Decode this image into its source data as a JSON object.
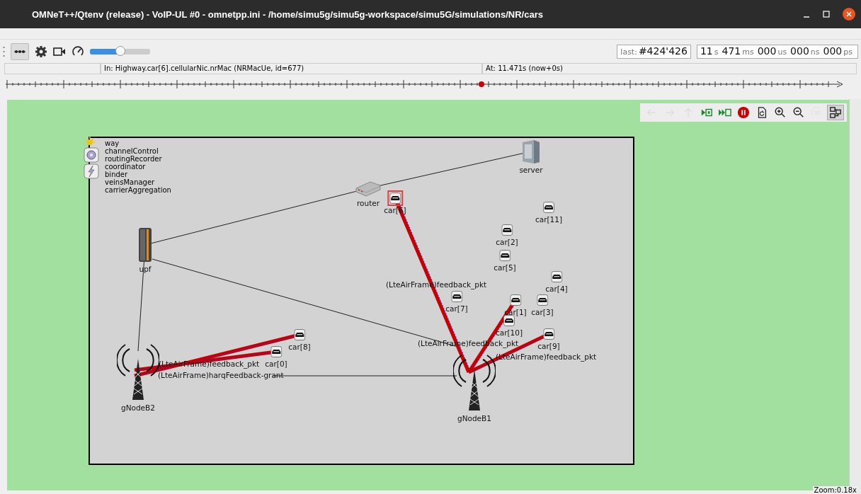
{
  "window": {
    "title": "OMNeT++/Qtenv (release) - VoIP-UL #0 - omnetpp.ini - /home/simu5g/simu5g-workspace/simu5G/simulations/NR/cars"
  },
  "toolbar": {
    "speed_slider": {
      "level": 0.5
    },
    "last_event": {
      "label": "last:",
      "value": "#424'426"
    },
    "sim_time": [
      {
        "value": "11",
        "unit": "s"
      },
      {
        "value": "471",
        "unit": "ms"
      },
      {
        "value": "000",
        "unit": "us"
      },
      {
        "value": "000",
        "unit": "ns"
      },
      {
        "value": "000",
        "unit": "ps"
      }
    ]
  },
  "status_bar": {
    "module": "In: Highway.car[6].cellularNic.nrMac (NRMacUe, id=677)",
    "time": "At: 11.471s (now+0s)"
  },
  "canvas_toolbar": [
    {
      "disabled": true
    },
    {
      "disabled": true
    },
    {
      "disabled": true
    },
    {
      "disabled": false
    },
    {
      "disabled": false
    },
    {
      "disabled": false
    },
    {
      "disabled": false
    },
    {
      "disabled": false
    },
    {
      "disabled": false
    },
    {
      "disabled": true
    },
    {
      "disabled": false,
      "selected": true
    }
  ],
  "modules": [
    "way",
    "channelControl",
    "routingRecorder",
    "coordinator",
    "binder",
    "veinsManager",
    "carrierAggregation"
  ],
  "nodes": [
    {
      "label": "server",
      "kind": "server",
      "selected": false
    },
    {
      "label": "router",
      "kind": "router",
      "selected": false
    },
    {
      "label": "car[6]",
      "kind": "car",
      "selected": true
    },
    {
      "label": "car[11]",
      "kind": "car",
      "selected": false
    },
    {
      "label": "car[2]",
      "kind": "car",
      "selected": false
    },
    {
      "label": "upf",
      "kind": "upf",
      "selected": false
    },
    {
      "label": "car[5]",
      "kind": "car",
      "selected": false
    },
    {
      "label": "car[4]",
      "kind": "car",
      "selected": false
    },
    {
      "label": "car[7]",
      "kind": "car",
      "selected": false
    },
    {
      "label": "car[1]",
      "kind": "car",
      "selected": false
    },
    {
      "label": "car[3]",
      "kind": "car",
      "selected": false
    },
    {
      "label": "car[10]",
      "kind": "car",
      "selected": false
    },
    {
      "label": "car[9]",
      "kind": "car",
      "selected": false
    },
    {
      "label": "car[8]",
      "kind": "car",
      "selected": false
    },
    {
      "label": "car[0]",
      "kind": "car",
      "selected": false
    },
    {
      "label": "gNodeB2",
      "kind": "antenna",
      "selected": false
    },
    {
      "label": "gNodeB1",
      "kind": "antenna",
      "selected": false
    }
  ],
  "messages": [
    "(LteAirFrame)feedback_pkt",
    "(LteAirFrame)feedback_pkt",
    "(LteAirFrame)feedback_pkt",
    "(LteAirFrame)feedback_pkt",
    "(LteAirFrame)harqFeedback-grant"
  ],
  "zoom": "Zoom:0.18x"
}
